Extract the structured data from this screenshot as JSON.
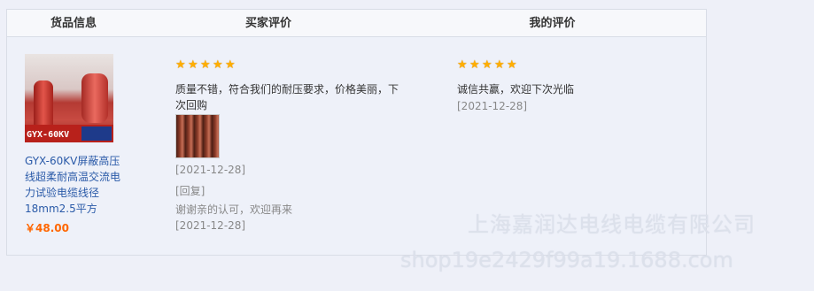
{
  "headers": {
    "goods": "货品信息",
    "buyer": "买家评价",
    "mine": "我的评价"
  },
  "product": {
    "image_band_text": "GYX-60KV",
    "name": "GYX-60KV屏蔽高压线超柔耐高温交流电力试验电缆线径18mm2.5平方",
    "price": "￥48.00"
  },
  "buyer_review": {
    "stars": 5,
    "comment": "质量不错，符合我们的耐压要求，价格美丽，下次回购",
    "date": "[2021-12-28]",
    "reply_tag": "[回复]",
    "reply_text": "谢谢亲的认可，欢迎再来",
    "reply_date": "[2021-12-28]"
  },
  "my_review": {
    "stars": 5,
    "comment": "诚信共赢，欢迎下次光临",
    "date": "[2021-12-28]"
  },
  "watermark": {
    "company": "上海嘉润达电线电缆有限公司",
    "url": "shop19e2429f99a19.1688.com"
  },
  "colors": {
    "star": "#ffae00",
    "price": "#ff6600",
    "link": "#2a5aa8"
  }
}
